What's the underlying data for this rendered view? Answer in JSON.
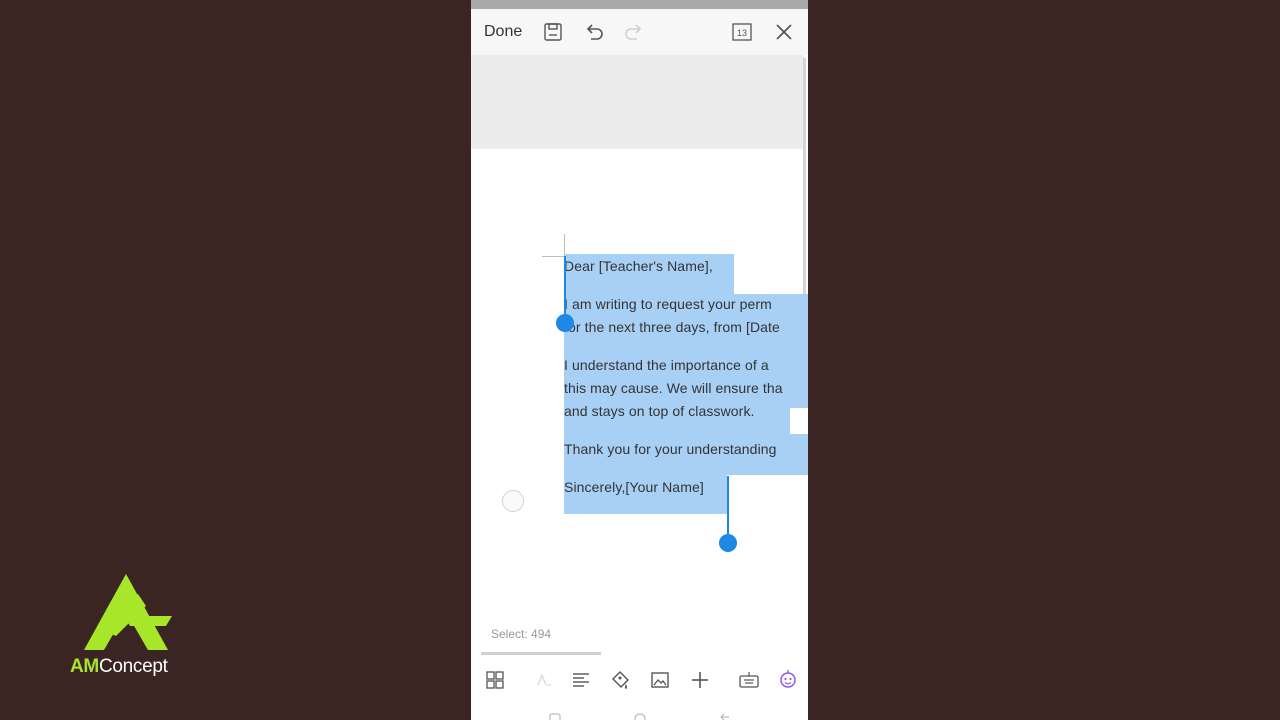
{
  "brand": {
    "am": "AM",
    "concept": "Concept",
    "logo_color": "#a8e62a"
  },
  "toolbar": {
    "done_label": "Done",
    "page_badge": "13",
    "icons": [
      "save-icon",
      "undo-icon",
      "redo-icon",
      "page-count-icon",
      "close-icon"
    ]
  },
  "document": {
    "lines": [
      "Dear [Teacher's Name],",
      "I am writing to request your perm",
      "for the next three days, from [Date",
      "I understand the importance of a",
      "this may cause. We will ensure tha",
      "and stays on top of classwork.",
      "Thank you for your understanding",
      "Sincerely,[Your Name]"
    ],
    "selection_color": "#a8d0f5",
    "handle_color": "#1e88e5"
  },
  "status": {
    "select_count": "Select: 494"
  },
  "bottom_bar": {
    "icons": [
      "grid-icon",
      "text-style-icon",
      "align-icon",
      "format-brush-icon",
      "image-icon",
      "add-icon",
      "keyboard-icon",
      "assistant-icon"
    ]
  }
}
